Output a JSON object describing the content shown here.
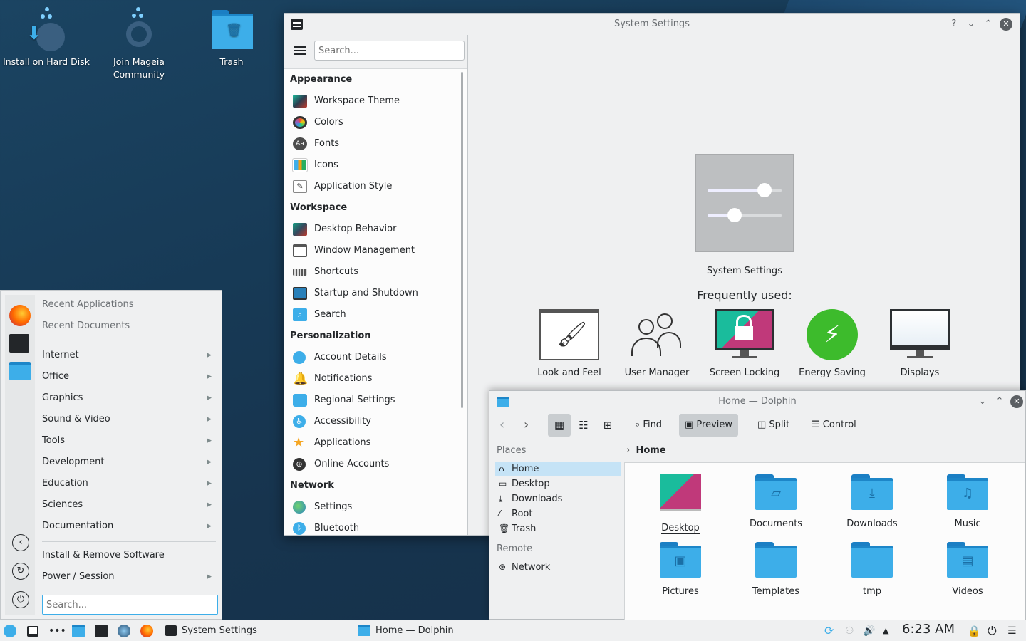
{
  "desktop": {
    "icons": [
      {
        "label": "Install on Hard Disk"
      },
      {
        "label": "Join Mageia Community"
      },
      {
        "label": "Trash"
      }
    ]
  },
  "settings": {
    "title": "System Settings",
    "help_glyph": "?",
    "search_placeholder": "Search...",
    "categories": [
      {
        "name": "Appearance",
        "items": [
          "Workspace Theme",
          "Colors",
          "Fonts",
          "Icons",
          "Application Style"
        ]
      },
      {
        "name": "Workspace",
        "items": [
          "Desktop Behavior",
          "Window Management",
          "Shortcuts",
          "Startup and Shutdown",
          "Search"
        ]
      },
      {
        "name": "Personalization",
        "items": [
          "Account Details",
          "Notifications",
          "Regional Settings",
          "Accessibility",
          "Applications",
          "Online Accounts"
        ]
      },
      {
        "name": "Network",
        "items": [
          "Settings",
          "Bluetooth"
        ]
      }
    ],
    "main": {
      "hero_label": "System Settings",
      "frequent_title": "Frequently used:",
      "frequent": [
        "Look and Feel",
        "User Manager",
        "Screen Locking",
        "Energy Saving",
        "Displays"
      ]
    }
  },
  "menu": {
    "recent_apps": "Recent Applications",
    "recent_docs": "Recent Documents",
    "categories": [
      "Internet",
      "Office",
      "Graphics",
      "Sound & Video",
      "Tools",
      "Development",
      "Education",
      "Sciences",
      "Documentation"
    ],
    "install_remove": "Install & Remove Software",
    "power_session": "Power / Session",
    "search_placeholder": "Search..."
  },
  "dolphin": {
    "title": "Home — Dolphin",
    "toolbar": {
      "find": "Find",
      "preview": "Preview",
      "split": "Split",
      "control": "Control"
    },
    "places_header": "Places",
    "places": [
      "Home",
      "Desktop",
      "Downloads",
      "Root",
      "Trash"
    ],
    "remote_header": "Remote",
    "remote": [
      "Network"
    ],
    "breadcrumb": "Home",
    "files": [
      "Desktop",
      "Documents",
      "Downloads",
      "Music",
      "Pictures",
      "Templates",
      "tmp",
      "Videos"
    ]
  },
  "taskbar": {
    "tasks": [
      "System Settings",
      "Home — Dolphin"
    ],
    "clock": "6:23 AM"
  }
}
